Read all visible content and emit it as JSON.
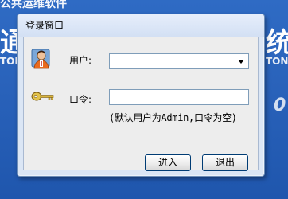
{
  "background": {
    "top_left_text": "公共运维软件",
    "big_left": "通",
    "big_right": "统",
    "small_left": "TONG",
    "small_right": "TONG",
    "digit": "0"
  },
  "window": {
    "title": "登录窗口"
  },
  "form": {
    "user_label": "用户:",
    "user_value": "",
    "password_label": "口令:",
    "password_value": "",
    "hint": "(默认用户为Admin,口令为空)"
  },
  "buttons": {
    "enter_label": "进入",
    "exit_label": "退出"
  },
  "icons": {
    "user": "user-icon",
    "key": "key-icon",
    "dropdown": "chevron-down-icon"
  }
}
